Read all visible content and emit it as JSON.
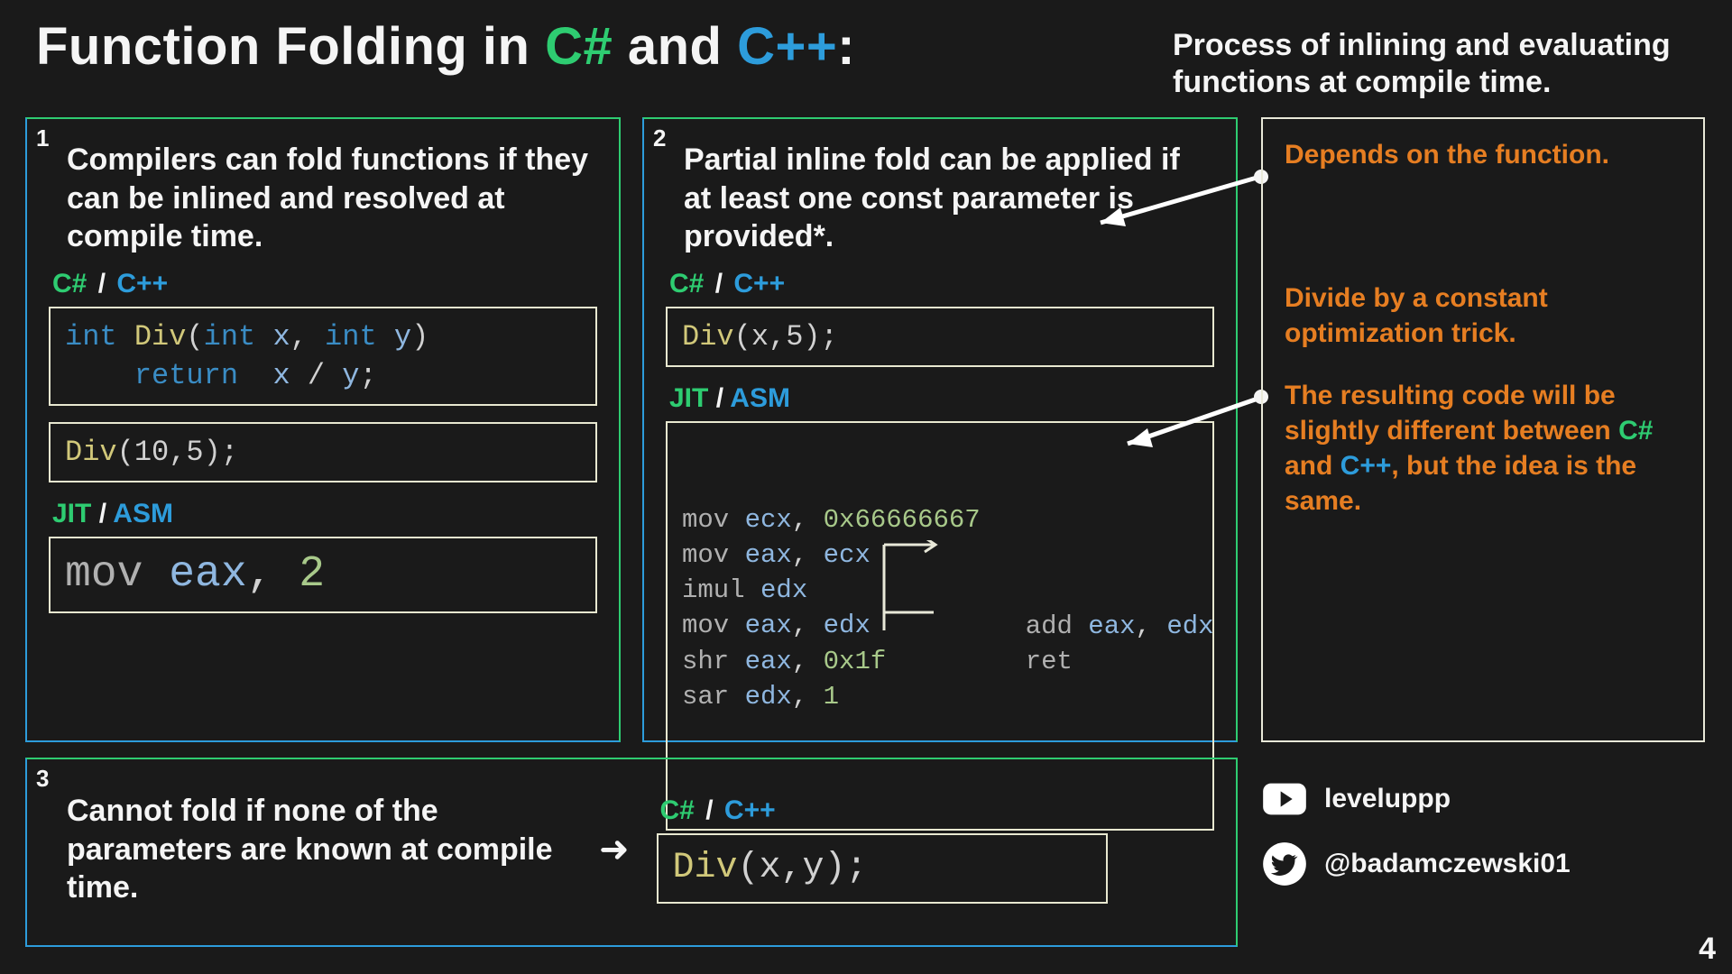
{
  "title": {
    "prefix": "Function Folding in ",
    "csharp": "C#",
    "and": " and ",
    "cpp": "C++",
    "suffix": ":"
  },
  "subtitle": "Process of inlining and evaluating functions at compile time.",
  "panel1": {
    "num": "1",
    "desc": "Compilers can fold functions if they can be inlined and resolved at compile time.",
    "lang": {
      "csharp": "C#",
      "slash": "/",
      "cpp": "C++"
    },
    "code1": {
      "l1_kw": "int",
      "l1_fn": "Div",
      "l1_p1": "(",
      "l1_kw2": "int",
      "l1_id1": " x",
      "l1_c": ", ",
      "l1_kw3": "int",
      "l1_id2": " y",
      "l1_p2": ")",
      "l2_kw": "return",
      "l2_sp": "  ",
      "l2_id1": "x",
      "l2_op": " / ",
      "l2_id2": "y",
      "l2_sc": ";"
    },
    "code2": {
      "fn": "Div",
      "args": "(10,5);"
    },
    "jit": {
      "jit": "JIT",
      "slash": "/",
      "asm": "ASM"
    },
    "asm": {
      "mn": "mov",
      "reg": " eax",
      "c": ", ",
      "val": "2"
    }
  },
  "panel2": {
    "num": "2",
    "desc": "Partial inline fold can be applied if at least one const parameter is provided*.",
    "lang": {
      "csharp": "C#",
      "slash": "/",
      "cpp": "C++"
    },
    "code": {
      "fn": "Div",
      "args": "(x,5);"
    },
    "jit": {
      "jit": "JIT",
      "slash": "/",
      "asm": "ASM"
    },
    "asm": {
      "l1": {
        "mn": "mov",
        "reg": " ecx",
        "c": ", ",
        "val": "0x66666667"
      },
      "l2": {
        "mn": "mov",
        "reg": " eax",
        "c": ", ",
        "reg2": "ecx"
      },
      "l3": {
        "mn": "imul",
        "reg": " edx"
      },
      "l4": {
        "mn": "mov",
        "reg": " eax",
        "c": ", ",
        "reg2": "edx"
      },
      "l5": {
        "mn": "shr",
        "reg": " eax",
        "c": ", ",
        "val": "0x1f"
      },
      "l6": {
        "mn": "sar",
        "reg": " edx",
        "c": ", ",
        "val": "1"
      },
      "r1": {
        "mn": "add",
        "reg": " eax",
        "c": ", ",
        "reg2": "edx"
      },
      "r2": {
        "mn": "ret"
      }
    }
  },
  "panel3": {
    "num": "3",
    "desc": "Cannot fold if none of the parameters are known at compile time.",
    "arrow": "➜",
    "lang": {
      "csharp": "C#",
      "slash": "/",
      "cpp": "C++"
    },
    "code": {
      "fn": "Div",
      "args": "(x,y);"
    }
  },
  "side": {
    "note1": "Depends on the function.",
    "note2": "Divide by a constant optimization trick.",
    "note3_pre": "The resulting code will be slightly different between ",
    "note3_csh": "C#",
    "note3_and": " and ",
    "note3_cpp": "C++",
    "note3_post": ", but the idea is the same."
  },
  "socials": {
    "youtube": "leveluppp",
    "twitter": "@badamczewski01"
  },
  "page": "4"
}
